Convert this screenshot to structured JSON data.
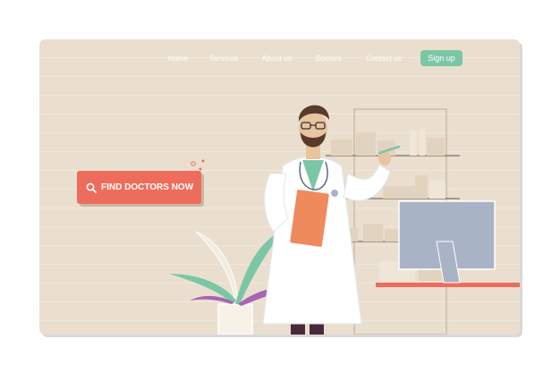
{
  "nav": {
    "items": [
      "Home",
      "Services",
      "About us",
      "Doctors",
      "Contact us"
    ],
    "signup_label": "Sign up"
  },
  "hero": {
    "cta_label": "FIND DOCTORS NOW"
  },
  "colors": {
    "page_bg": "#eadfcf",
    "accent": "#ee6c5c",
    "signup": "#7bc7a5",
    "monitor": "#a9b3c6"
  },
  "icons": [
    "search-icon",
    "doctor-illustration",
    "plant-illustration",
    "monitor-illustration",
    "shelf-illustration"
  ]
}
